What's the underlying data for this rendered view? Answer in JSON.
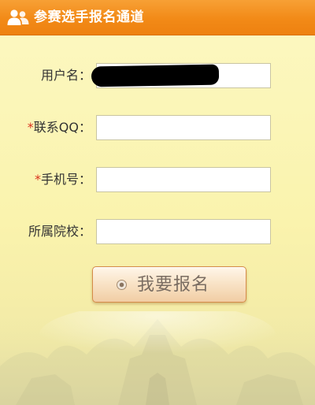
{
  "header": {
    "title": "参赛选手报名通道",
    "icon": "users-icon"
  },
  "form": {
    "fields": [
      {
        "label": "用户名：",
        "required": false,
        "value": "",
        "redacted": true
      },
      {
        "label": "联系QQ：",
        "required": true,
        "value": ""
      },
      {
        "label": "手机号：",
        "required": true,
        "value": ""
      },
      {
        "label": "所属院校：",
        "required": false,
        "value": ""
      }
    ],
    "required_mark": "*",
    "submit_label": "我要报名",
    "submit_icon": "radio-dot-icon"
  },
  "colors": {
    "header_orange": "#f28a17",
    "panel_yellow": "#fbf5b4",
    "required_red": "#d9331e",
    "button_text": "#7a6d62"
  }
}
